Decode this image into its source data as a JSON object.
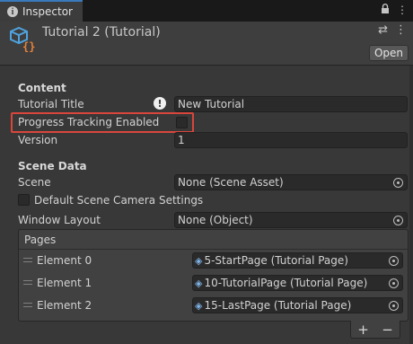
{
  "tab": {
    "label": "Inspector"
  },
  "header": {
    "title": "Tutorial 2 (Tutorial)",
    "open_label": "Open"
  },
  "content": {
    "section_label": "Content",
    "tutorial_title_label": "Tutorial Title",
    "tutorial_title_value": "New Tutorial",
    "progress_label": "Progress Tracking Enabled",
    "progress_checked": false,
    "version_label": "Version",
    "version_value": "1"
  },
  "scene": {
    "section_label": "Scene Data",
    "scene_label": "Scene",
    "scene_value": "None (Scene Asset)",
    "default_camera_label": "Default Scene Camera Settings",
    "default_camera_checked": false,
    "window_layout_label": "Window Layout",
    "window_layout_value": "None (Object)"
  },
  "pages": {
    "title": "Pages",
    "elements": [
      {
        "label": "Element 0",
        "value": "5-StartPage (Tutorial Page)"
      },
      {
        "label": "Element 1",
        "value": "10-TutorialPage (Tutorial Page)"
      },
      {
        "label": "Element 2",
        "value": "15-LastPage (Tutorial Page)"
      }
    ],
    "add_symbol": "+",
    "remove_symbol": "−"
  },
  "colors": {
    "highlight": "#d9463c",
    "asset_icon": "#4fa3e0",
    "tab_accent": "#3a79bb"
  },
  "icons": [
    "info-icon",
    "lock-icon",
    "menu-icon",
    "tutorial-asset-icon",
    "settings-sliders-icon",
    "more-icon",
    "warning-icon",
    "object-picker-icon",
    "drag-handle-icon",
    "tutorial-page-icon"
  ]
}
